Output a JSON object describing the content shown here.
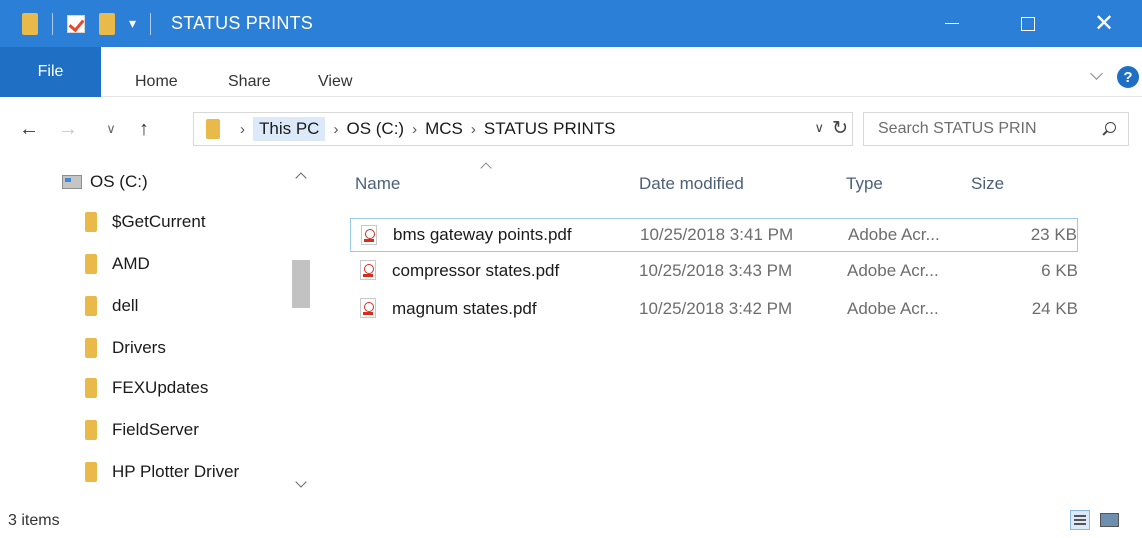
{
  "window": {
    "title": "STATUS PRINTS"
  },
  "ribbon": {
    "tabs": [
      {
        "label": "File"
      },
      {
        "label": "Home"
      },
      {
        "label": "Share"
      },
      {
        "label": "View"
      }
    ],
    "help_label": "?"
  },
  "address": {
    "breadcrumbs": [
      "This PC",
      "OS (C:)",
      "MCS",
      "STATUS PRINTS"
    ]
  },
  "search": {
    "placeholder": "Search STATUS PRIN"
  },
  "navigation": {
    "root": "OS (C:)",
    "folders": [
      "$GetCurrent",
      "AMD",
      "dell",
      "Drivers",
      "FEXUpdates",
      "FieldServer",
      "HP Plotter Driver"
    ]
  },
  "file_list": {
    "columns": [
      "Name",
      "Date modified",
      "Type",
      "Size"
    ],
    "files": [
      {
        "name": "bms gateway points.pdf",
        "date": "10/25/2018 3:41 PM",
        "type": "Adobe Acr...",
        "size": "23 KB"
      },
      {
        "name": "compressor states.pdf",
        "date": "10/25/2018 3:43 PM",
        "type": "Adobe Acr...",
        "size": "6 KB"
      },
      {
        "name": "magnum states.pdf",
        "date": "10/25/2018 3:42 PM",
        "type": "Adobe Acr...",
        "size": "24 KB"
      }
    ]
  },
  "status": {
    "item_count": "3 items"
  },
  "colors": {
    "titlebar": "#2b7fd6",
    "file_tab": "#1f6fc5",
    "folder": "#e9b949",
    "pdf_red": "#d62d20",
    "selection_border": "#99c9ef"
  },
  "icons": {
    "folder": "folder-icon",
    "pdf": "pdf-file-icon",
    "drive": "drive-icon",
    "search": "search-icon"
  }
}
